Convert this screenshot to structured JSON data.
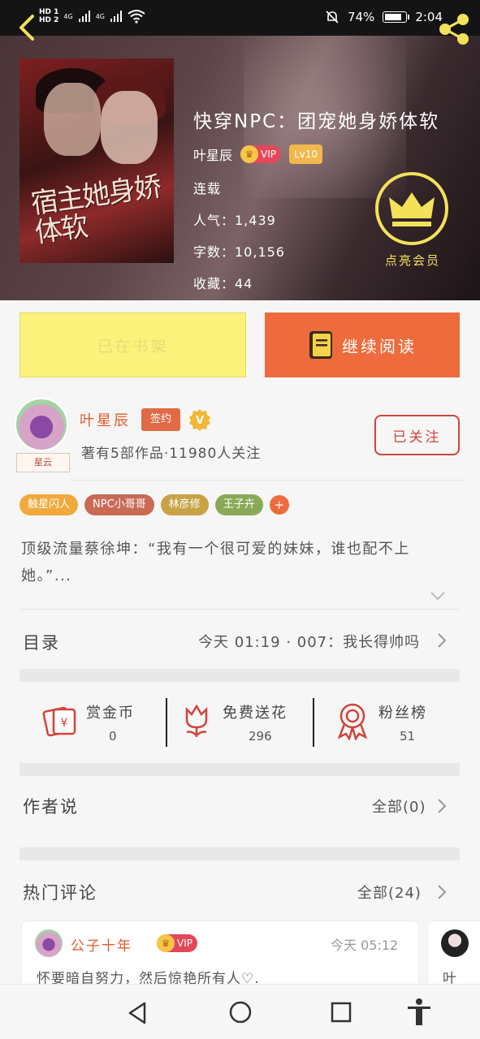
{
  "status_bar": {
    "hd1": "HD 1",
    "hd2": "HD 2",
    "signal1": "4G",
    "signal2": "4G",
    "battery": "74%",
    "battery_level": 0.74,
    "time": "2:04"
  },
  "book": {
    "title": "快穿NPC：团宠她身娇体软",
    "author": "叶星辰",
    "vip": "VIP",
    "level": "Lv10",
    "status": "连载",
    "popularity": "人气：1,439",
    "word_count": "字数：10,156",
    "favorites": "收藏：44",
    "cover_title": "宿主她身娇体软",
    "vip_member": "点亮会员"
  },
  "actions": {
    "shelf": "已在书架",
    "read": "继续阅读"
  },
  "author_card": {
    "name": "叶星辰",
    "sign": "签约",
    "verified": "V",
    "stats": "著有5部作品·11980人关注",
    "avatar_tag": "星云",
    "follow": "已关注"
  },
  "tags": [
    {
      "label": "触星闪人",
      "color": "#f0a93c"
    },
    {
      "label": "NPC小哥哥",
      "color": "#c96a55"
    },
    {
      "label": "林彦修",
      "color": "#c9a245"
    },
    {
      "label": "王子卉",
      "color": "#8aa957"
    }
  ],
  "tag_add": "+",
  "intro": "顶级流量蔡徐坤：“我有一个很可爱的妹妹，谁也配不上她。”...",
  "catalog": {
    "label": "目录",
    "latest": "今天 01:19 · 007：我长得帅吗"
  },
  "stats": [
    {
      "label": "赏金币",
      "value": "0"
    },
    {
      "label": "免费送花",
      "value": "296"
    },
    {
      "label": "粉丝榜",
      "value": "51"
    }
  ],
  "author_says": {
    "label": "作者说",
    "all": "全部(0)"
  },
  "comments": {
    "label": "热门评论",
    "all": "全部(24)",
    "items": [
      {
        "user": "公子十年",
        "vip": "VIP",
        "time": "今天 05:12",
        "text": "怀要暗自努力，然后惊艳所有人♡."
      },
      {
        "user": "",
        "text": "叶"
      }
    ]
  },
  "colors": {
    "accent": "#ed6b3c",
    "shelf_yellow": "#fbf27b",
    "vip_gold": "#f3e15a",
    "author_red": "#e25a2c"
  }
}
